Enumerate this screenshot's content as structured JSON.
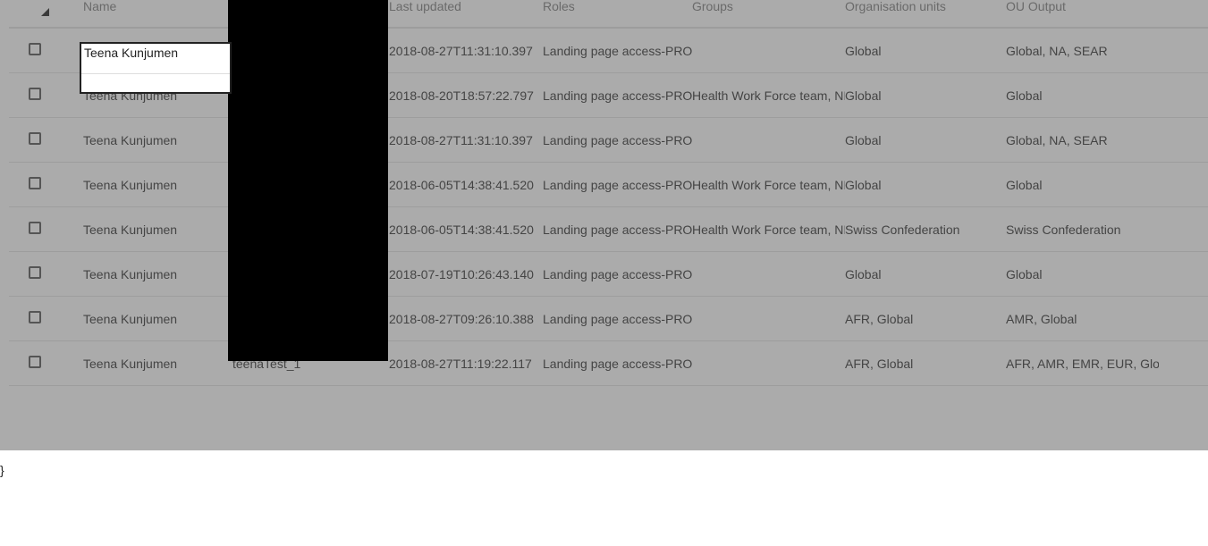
{
  "table": {
    "headers": {
      "name": "Name",
      "last_updated": "Last updated",
      "roles": "Roles",
      "groups": "Groups",
      "organisation_units": "Organisation units",
      "ou_output": "OU Output"
    },
    "rows": [
      {
        "name": "Teena Kunjumen",
        "username": "",
        "last_updated": "2018-08-27T11:31:10.397",
        "roles": "Landing page access-PROI-",
        "groups": "",
        "org_units": "Global",
        "ou_output": "Global, NA, SEAR"
      },
      {
        "name": "Teena Kunjumen",
        "username": "",
        "last_updated": "2018-08-20T18:57:22.797",
        "roles": "Landing page access-PROI",
        "groups": "Health Work Force team, NI",
        "org_units": "Global",
        "ou_output": "Global"
      },
      {
        "name": "Teena Kunjumen",
        "username": "",
        "last_updated": "2018-08-27T11:31:10.397",
        "roles": "Landing page access-PROI-",
        "groups": "",
        "org_units": "Global",
        "ou_output": "Global, NA, SEAR"
      },
      {
        "name": "Teena Kunjumen",
        "username": "",
        "last_updated": "2018-06-05T14:38:41.520",
        "roles": "Landing page access-PROI",
        "groups": "Health Work Force team, NI",
        "org_units": "Global",
        "ou_output": "Global"
      },
      {
        "name": "Teena Kunjumen",
        "username": "",
        "last_updated": "2018-06-05T14:38:41.520",
        "roles": "Landing page access-PROI",
        "groups": "Health Work Force team, NI",
        "org_units": "Swiss Confederation",
        "ou_output": "Swiss Confederation"
      },
      {
        "name": "Teena Kunjumen",
        "username": "",
        "last_updated": "2018-07-19T10:26:43.140",
        "roles": "Landing page access-PROI-",
        "groups": "",
        "org_units": "Global",
        "ou_output": "Global"
      },
      {
        "name": "Teena Kunjumen",
        "username": "",
        "last_updated": "2018-08-27T09:26:10.388",
        "roles": "Landing page access-PROI-",
        "groups": "",
        "org_units": "AFR, Global",
        "ou_output": "AMR, Global"
      },
      {
        "name": "Teena Kunjumen",
        "username": "teenaTest_1",
        "last_updated": "2018-08-27T11:19:22.117",
        "roles": "Landing page access-PROI-",
        "groups": "",
        "org_units": "AFR, Global",
        "ou_output": "AFR, AMR, EMR, EUR, Globa"
      }
    ]
  },
  "popup": {
    "text": "Teena Kunjumen"
  },
  "stray_text": "}"
}
